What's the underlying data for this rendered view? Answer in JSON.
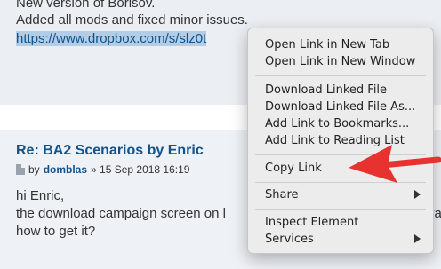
{
  "post1": {
    "line1": "New version of Borisov.",
    "line2": "Added all mods and fixed minor issues.",
    "link_text": "https://www.dropbox.com/s/slz0t"
  },
  "post2": {
    "title": "Re: BA2 Scenarios by Enric",
    "by_prefix": "by",
    "author": "domblas",
    "date": "» 15 Sep 2018 16:19",
    "line1": "hi Enric,",
    "line2": "the download campaign screen on l",
    "line2_tail": "va",
    "line3": "how to get it?"
  },
  "context_menu": {
    "items": [
      "Open Link in New Tab",
      "Open Link in New Window",
      "Download Linked File",
      "Download Linked File As...",
      "Add Link to Bookmarks...",
      "Add Link to Reading List",
      "Copy Link",
      "Share",
      "Inspect Element",
      "Services"
    ]
  },
  "colors": {
    "annotation_arrow": "#e8322f",
    "link": "#105289"
  },
  "icons": [
    "document-icon",
    "submenu-arrow-icon",
    "red-pointer-arrow"
  ]
}
